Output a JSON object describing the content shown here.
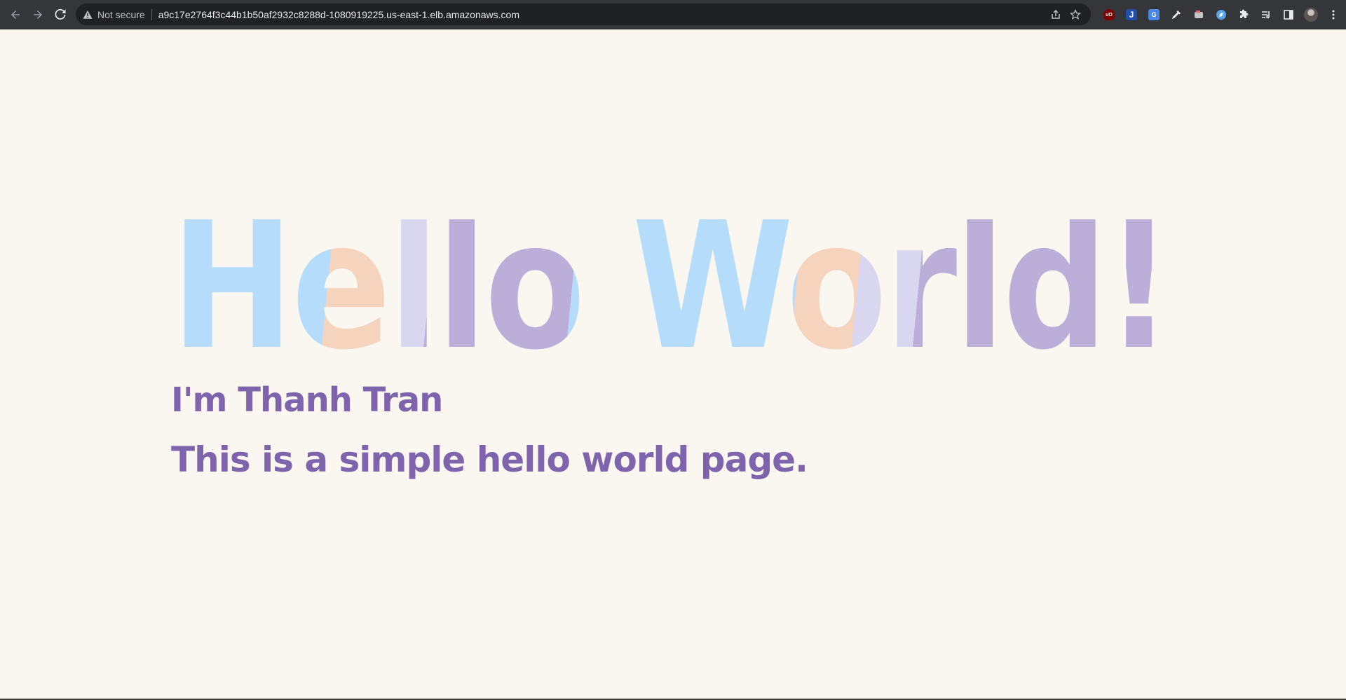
{
  "browser": {
    "security_label": "Not secure",
    "url": "a9c17e2764f3c44b1b50af2932c8288d-1080919225.us-east-1.elb.amazonaws.com",
    "toolbar_icons": [
      "back-icon",
      "forward-icon",
      "reload-icon"
    ],
    "omnibox_icons": [
      "share-icon",
      "bookmark-star-icon"
    ],
    "extension_icons": [
      "ublock-origin-icon",
      "jira-icon",
      "google-translate-icon",
      "eyedropper-icon",
      "screenshot-icon",
      "compass-icon",
      "extensions-puzzle-icon",
      "reading-list-icon",
      "side-panel-icon",
      "profile-avatar",
      "menu-kebab-icon"
    ],
    "extension_labels": {
      "ublock": "uO",
      "jira": "J",
      "translate": "G"
    }
  },
  "page": {
    "hero_title": "Hello World!",
    "subtitle": "I'm Thanh Tran",
    "tagline": "This is a simple hello world page."
  },
  "colors": {
    "background": "#faf7f1",
    "text_purple": "#7e64ad",
    "hero_blue": "#b5ddfb",
    "hero_peach": "#f5d3bd",
    "hero_lavender": "#d9d6ef",
    "hero_purple": "#bbaed9"
  }
}
